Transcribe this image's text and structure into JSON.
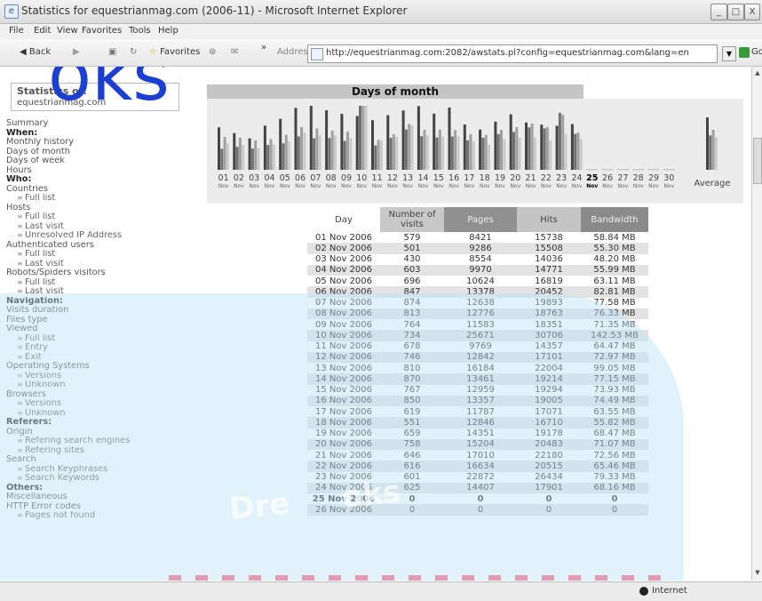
{
  "window": {
    "title": "Statistics for equestrianmag.com (2006-11) - Microsoft Internet Explorer",
    "btn_minimize": "_",
    "btn_maximize": "□",
    "btn_close": "X"
  },
  "menu_bar": [
    "File",
    "Edit",
    "View",
    "Favorites",
    "Tools",
    "Help"
  ],
  "toolbar": {
    "back": "Back",
    "favorites": "Favorites",
    "more": "»",
    "address_label": "Address",
    "address_url": "http://equestrianmag.com:2082/awstats.pl?config=equestrianmag.com&lang=en",
    "go": "Go"
  },
  "sidebar": {
    "stats_title": "Statistics of:",
    "stats_site": "equestrianmag.com",
    "items": [
      {
        "label": "Summary",
        "kind": "link"
      },
      {
        "label": "When:",
        "kind": "heading"
      },
      {
        "label": "Monthly history",
        "kind": "link"
      },
      {
        "label": "Days of month",
        "kind": "link"
      },
      {
        "label": "Days of week",
        "kind": "link"
      },
      {
        "label": "Hours",
        "kind": "link"
      },
      {
        "label": "Who:",
        "kind": "heading"
      },
      {
        "label": "Countries",
        "kind": "link"
      },
      {
        "label": "Full list",
        "kind": "sub"
      },
      {
        "label": "Hosts",
        "kind": "link"
      },
      {
        "label": "Full list",
        "kind": "sub"
      },
      {
        "label": "Last visit",
        "kind": "sub"
      },
      {
        "label": "Unresolved IP Address",
        "kind": "sub"
      },
      {
        "label": "Authenticated users",
        "kind": "link"
      },
      {
        "label": "Full list",
        "kind": "sub"
      },
      {
        "label": "Last visit",
        "kind": "sub"
      },
      {
        "label": "Robots/Spiders visitors",
        "kind": "link"
      },
      {
        "label": "Full list",
        "kind": "sub"
      },
      {
        "label": "Last visit",
        "kind": "sub"
      },
      {
        "label": "Navigation:",
        "kind": "heading"
      },
      {
        "label": "Visits duration",
        "kind": "link"
      },
      {
        "label": "Files type",
        "kind": "link"
      },
      {
        "label": "Viewed",
        "kind": "link"
      },
      {
        "label": "Full list",
        "kind": "sub"
      },
      {
        "label": "Entry",
        "kind": "sub"
      },
      {
        "label": "Exit",
        "kind": "sub"
      },
      {
        "label": "Operating Systems",
        "kind": "link"
      },
      {
        "label": "Versions",
        "kind": "sub"
      },
      {
        "label": "Unknown",
        "kind": "sub"
      },
      {
        "label": "Browsers",
        "kind": "link"
      },
      {
        "label": "Versions",
        "kind": "sub"
      },
      {
        "label": "Unknown",
        "kind": "sub"
      },
      {
        "label": "Referers:",
        "kind": "heading"
      },
      {
        "label": "Origin",
        "kind": "link"
      },
      {
        "label": "Refering search engines",
        "kind": "sub"
      },
      {
        "label": "Refering sites",
        "kind": "sub"
      },
      {
        "label": "Search",
        "kind": "link"
      },
      {
        "label": "Search Keyphrases",
        "kind": "sub"
      },
      {
        "label": "Search Keywords",
        "kind": "sub"
      },
      {
        "label": "Others:",
        "kind": "heading"
      },
      {
        "label": "Miscellaneous",
        "kind": "link"
      },
      {
        "label": "HTTP Error codes",
        "kind": "link"
      },
      {
        "label": "Pages not found",
        "kind": "sub"
      }
    ]
  },
  "panel": {
    "title": "Days of month"
  },
  "chart_data": {
    "type": "bar",
    "title": "Days of month",
    "categories": [
      "01",
      "02",
      "03",
      "04",
      "05",
      "06",
      "07",
      "08",
      "09",
      "10",
      "11",
      "12",
      "13",
      "14",
      "15",
      "16",
      "17",
      "18",
      "19",
      "20",
      "21",
      "22",
      "23",
      "24",
      "25",
      "26",
      "27",
      "28",
      "29",
      "30"
    ],
    "month_label": "Nov",
    "current_day": "25",
    "average_label": "Average",
    "series": [
      {
        "name": "Number of visits",
        "color": "#444444",
        "values": [
          579,
          501,
          430,
          603,
          696,
          847,
          874,
          813,
          764,
          734,
          678,
          746,
          810,
          870,
          767,
          850,
          619,
          551,
          659,
          758,
          646,
          616,
          601,
          625,
          0,
          0,
          0,
          0,
          0,
          0
        ]
      },
      {
        "name": "Pages",
        "color": "#707070",
        "values": [
          8421,
          9286,
          8554,
          9970,
          10624,
          13378,
          12638,
          12776,
          11583,
          25671,
          9769,
          12842,
          16184,
          13461,
          12959,
          13357,
          11787,
          12846,
          14351,
          15204,
          17010,
          16634,
          22872,
          14407,
          0,
          0,
          0,
          0,
          0,
          0
        ]
      },
      {
        "name": "Hits",
        "color": "#a0a0a0",
        "values": [
          15738,
          15508,
          14036,
          14771,
          16819,
          20452,
          19893,
          18763,
          18351,
          30706,
          14357,
          17101,
          22004,
          19214,
          19294,
          19005,
          17071,
          16710,
          19178,
          20483,
          22180,
          20515,
          26434,
          17901,
          0,
          0,
          0,
          0,
          0,
          0
        ]
      },
      {
        "name": "Bandwidth",
        "color": "#cacaca",
        "values_mb": [
          58.84,
          55.3,
          48.2,
          55.99,
          63.11,
          82.81,
          77.58,
          76.33,
          71.35,
          142.53,
          64.47,
          72.97,
          99.05,
          77.15,
          73.93,
          74.49,
          63.55,
          55.82,
          68.47,
          71.07,
          72.56,
          65.46,
          79.33,
          68.16,
          0,
          0,
          0,
          0,
          0,
          0
        ]
      }
    ],
    "average": {
      "visits": 715,
      "pages": 13777,
      "hits": 19199,
      "bandwidth_mb": 72.3
    }
  },
  "table": {
    "headers": [
      "Day",
      "Number of visits",
      "Pages",
      "Hits",
      "Bandwidth"
    ],
    "rows": [
      [
        "01 Nov 2006",
        "579",
        "8421",
        "15738",
        "58.84 MB"
      ],
      [
        "02 Nov 2006",
        "501",
        "9286",
        "15508",
        "55.30 MB"
      ],
      [
        "03 Nov 2006",
        "430",
        "8554",
        "14036",
        "48.20 MB"
      ],
      [
        "04 Nov 2006",
        "603",
        "9970",
        "14771",
        "55.99 MB"
      ],
      [
        "05 Nov 2006",
        "696",
        "10624",
        "16819",
        "63.11 MB"
      ],
      [
        "06 Nov 2006",
        "847",
        "13378",
        "20452",
        "82.81 MB"
      ],
      [
        "07 Nov 2006",
        "874",
        "12638",
        "19893",
        "77.58 MB"
      ],
      [
        "08 Nov 2006",
        "813",
        "12776",
        "18763",
        "76.33 MB"
      ],
      [
        "09 Nov 2006",
        "764",
        "11583",
        "18351",
        "71.35 MB"
      ],
      [
        "10 Nov 2006",
        "734",
        "25671",
        "30706",
        "142.53 MB"
      ],
      [
        "11 Nov 2006",
        "678",
        "9769",
        "14357",
        "64.47 MB"
      ],
      [
        "12 Nov 2006",
        "746",
        "12842",
        "17101",
        "72.97 MB"
      ],
      [
        "13 Nov 2006",
        "810",
        "16184",
        "22004",
        "99.05 MB"
      ],
      [
        "14 Nov 2006",
        "870",
        "13461",
        "19214",
        "77.15 MB"
      ],
      [
        "15 Nov 2006",
        "767",
        "12959",
        "19294",
        "73.93 MB"
      ],
      [
        "16 Nov 2006",
        "850",
        "13357",
        "19005",
        "74.49 MB"
      ],
      [
        "17 Nov 2006",
        "619",
        "11787",
        "17071",
        "63.55 MB"
      ],
      [
        "18 Nov 2006",
        "551",
        "12846",
        "16710",
        "55.82 MB"
      ],
      [
        "19 Nov 2006",
        "659",
        "14351",
        "19178",
        "68.47 MB"
      ],
      [
        "20 Nov 2006",
        "758",
        "15204",
        "20483",
        "71.07 MB"
      ],
      [
        "21 Nov 2006",
        "646",
        "17010",
        "22180",
        "72.56 MB"
      ],
      [
        "22 Nov 2006",
        "616",
        "16634",
        "20515",
        "65.46 MB"
      ],
      [
        "23 Nov 2006",
        "601",
        "22872",
        "26434",
        "79.33 MB"
      ],
      [
        "24 Nov 2006",
        "625",
        "14407",
        "17901",
        "68.16 MB"
      ],
      [
        "25 Nov 2006",
        "0",
        "0",
        "0",
        "0"
      ],
      [
        "26 Nov 2006",
        "0",
        "0",
        "0",
        "0"
      ]
    ],
    "current_row_index": 24
  },
  "status": {
    "zone": "Internet"
  },
  "watermark": {
    "top_text": "oks",
    "bottom_text": "Dre     oks",
    "color_top": "#1a3fd1",
    "color_band": "#bfe3f3"
  }
}
